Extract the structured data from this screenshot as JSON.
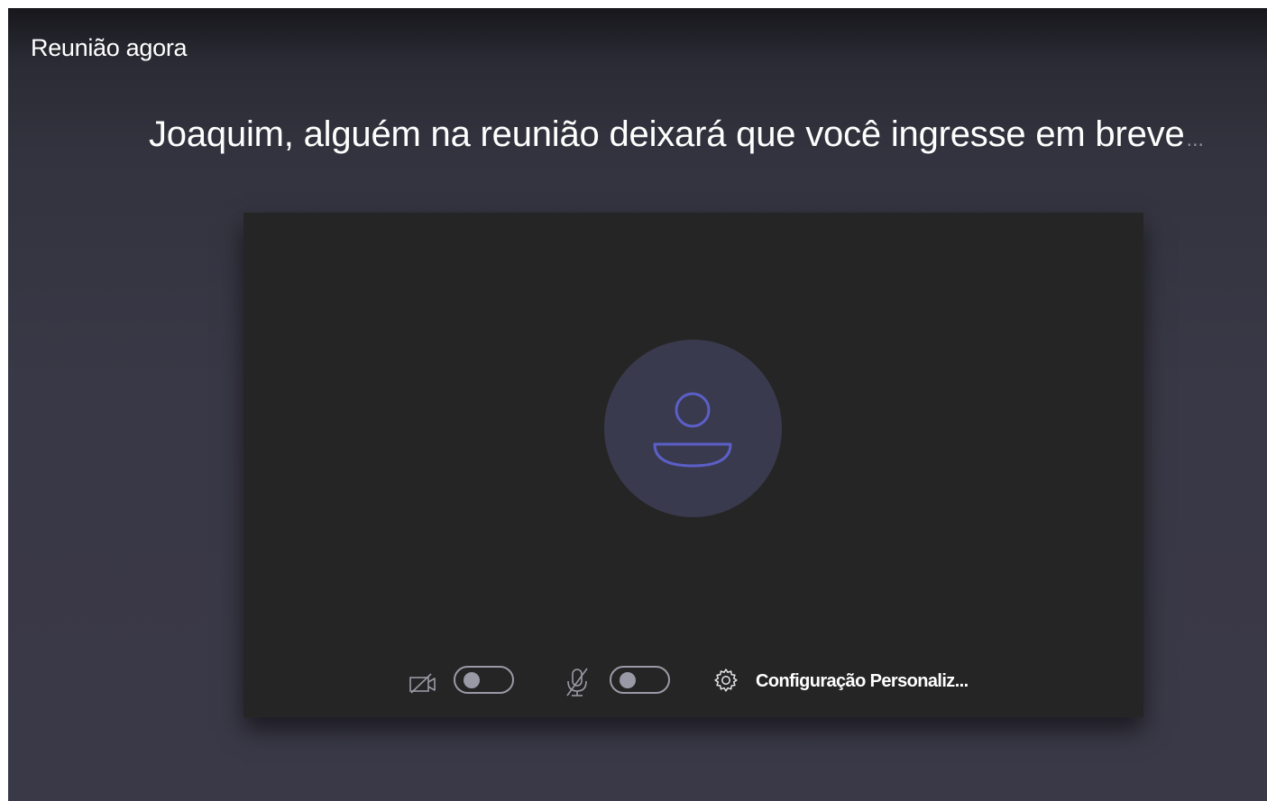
{
  "window": {
    "title": "Reunião agora"
  },
  "lobby": {
    "message": "Joaquim, alguém na reunião deixará que você ingresse em breve",
    "ellipsis": "..."
  },
  "preview": {
    "avatar_icon": "person-icon",
    "controls": {
      "camera_icon": "camera-off-icon",
      "camera_on": false,
      "mic_icon": "mic-off-icon",
      "mic_on": false,
      "settings_icon": "gear-icon",
      "settings_label": "Configuração Personaliz..."
    }
  },
  "colors": {
    "background": "#3a3947",
    "video_background": "#252525",
    "avatar_circle": "#3a3a4e",
    "avatar_accent": "#5b5fc7",
    "toggle_off": "#9a9aa6",
    "text": "#ffffff"
  }
}
